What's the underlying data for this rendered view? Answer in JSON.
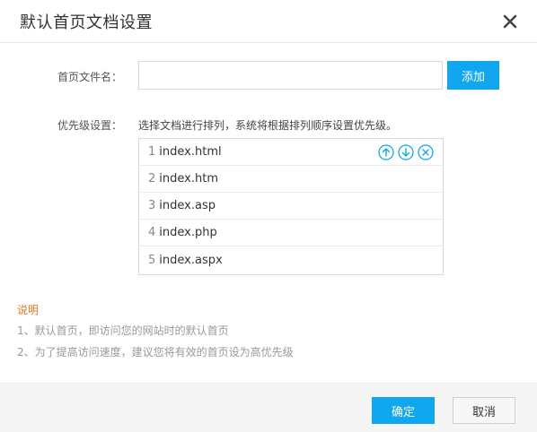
{
  "dialog": {
    "title": "默认首页文档设置"
  },
  "form": {
    "name_label": "首页文件名：",
    "name_value": "",
    "name_placeholder": "",
    "add_label": "添加",
    "priority_label": "优先级设置：",
    "priority_hint": "选择文档进行排列，系统将根据排列顺序设置优先级。"
  },
  "list": {
    "items": [
      {
        "num": "1",
        "name": "index.html"
      },
      {
        "num": "2",
        "name": "index.htm"
      },
      {
        "num": "3",
        "name": "index.asp"
      },
      {
        "num": "4",
        "name": "index.php"
      },
      {
        "num": "5",
        "name": "index.aspx"
      }
    ]
  },
  "notes": {
    "title": "说明",
    "lines": [
      "1、默认首页，即访问您的网站时的默认首页",
      "2、为了提高访问速度，建议您将有效的首页设为高优先级"
    ]
  },
  "footer": {
    "confirm_label": "确定",
    "cancel_label": "取消"
  },
  "colors": {
    "accent": "#10a7f0",
    "notes_title": "#e07b1f"
  }
}
